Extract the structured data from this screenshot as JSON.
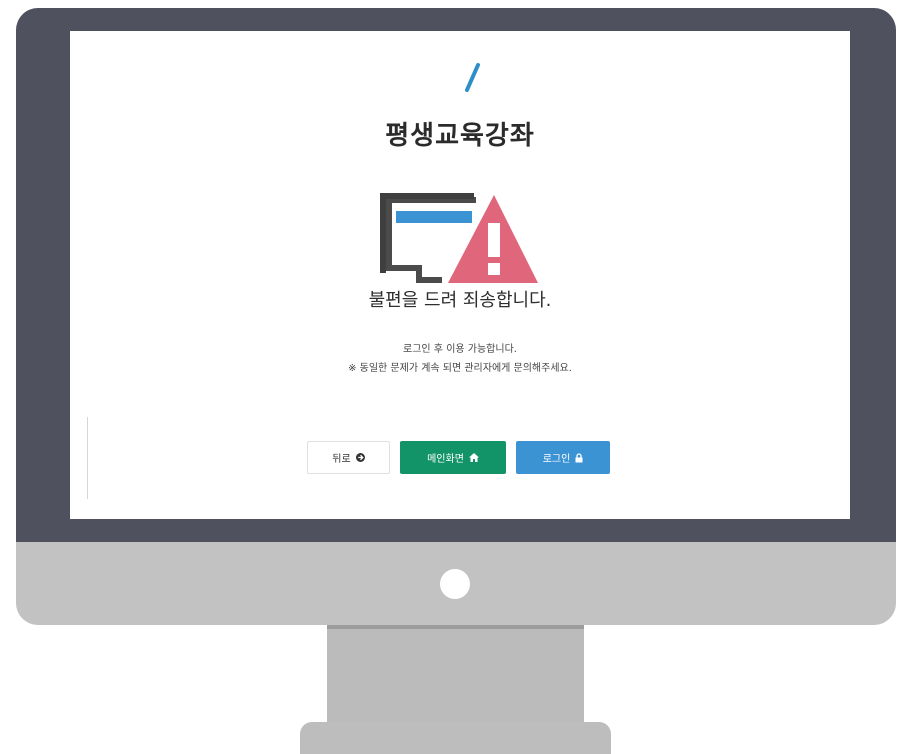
{
  "logo": {
    "icon": "slash-logo-icon",
    "color": "#2e8fc7"
  },
  "page": {
    "title": "평생교육강좌"
  },
  "error": {
    "illustration": "monitor-warning-icon",
    "heading": "불편을 드려 죄송합니다.",
    "message_line1": "로그인 후 이용 가능합니다.",
    "message_line2": "※ 동일한 문제가 계속 되면 관리자에게 문의해주세요."
  },
  "actions": {
    "back_label": "뒤로",
    "back_icon": "circle-arrow-icon",
    "home_label": "메인화면",
    "home_icon": "home-icon",
    "login_label": "로그인",
    "login_icon": "lock-icon"
  },
  "colors": {
    "bezel": "#50515e",
    "home_button": "#129468",
    "login_button": "#3c93d4",
    "warning": "#e0667c"
  }
}
